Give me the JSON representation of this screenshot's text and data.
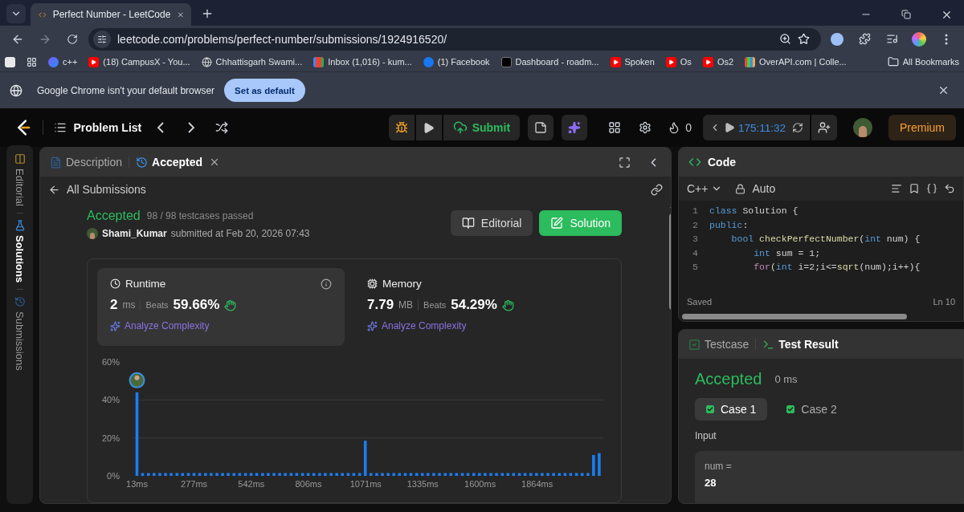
{
  "browser": {
    "tabs": [
      {
        "title": "Perfect Number - LeetCode",
        "selected": true
      }
    ],
    "url": "leetcode.com/problems/perfect-number/submissions/1924916520/",
    "bookmarks": [
      {
        "label": "c++",
        "kind": "site"
      },
      {
        "label": "(18) CampusX - You...",
        "kind": "youtube"
      },
      {
        "label": "Chhattisgarh Swami...",
        "kind": "globe"
      },
      {
        "label": "Inbox (1,016) - kum...",
        "kind": "mail"
      },
      {
        "label": "(1) Facebook",
        "kind": "facebook"
      },
      {
        "label": "Dashboard - roadm...",
        "kind": "dark"
      },
      {
        "label": "Spoken",
        "kind": "youtube"
      },
      {
        "label": "Os",
        "kind": "youtube"
      },
      {
        "label": "Os2",
        "kind": "youtube"
      },
      {
        "label": "OverAPI.com | Colle...",
        "kind": "stripes"
      }
    ],
    "all_bookmarks": "All Bookmarks",
    "infobar": {
      "message": "Google Chrome isn't your default browser",
      "button": "Set as default"
    }
  },
  "header": {
    "problem_list": "Problem List",
    "submit": "Submit",
    "streak": "0",
    "timer": "175:11:32",
    "premium": "Premium"
  },
  "side_tabs": [
    {
      "label": "Editorial",
      "selected": false
    },
    {
      "label": "Solutions",
      "selected": true
    },
    {
      "label": "Submissions",
      "selected": false
    }
  ],
  "left_panel": {
    "tabs": [
      {
        "label": "Description",
        "selected": false
      },
      {
        "label": "Accepted",
        "selected": true
      }
    ],
    "back_link": "All Submissions",
    "submission": {
      "status": "Accepted",
      "testcases": "98 / 98 testcases passed",
      "user": "Shami_Kumar",
      "submitted": "submitted at Feb 20, 2026 07:43",
      "buttons": [
        {
          "label": "Editorial",
          "kind": "secondary"
        },
        {
          "label": "Solution",
          "kind": "primary"
        }
      ]
    },
    "stats": [
      {
        "title": "Runtime",
        "value": "2",
        "unit": "ms",
        "beats_label": "Beats",
        "beats": "59.66%",
        "analyze": "Analyze Complexity",
        "selected": true
      },
      {
        "title": "Memory",
        "value": "7.79",
        "unit": "MB",
        "beats_label": "Beats",
        "beats": "54.29%",
        "analyze": "Analyze Complexity",
        "selected": false
      }
    ],
    "chart_data": {
      "type": "bar",
      "xlim": [
        0,
        2170
      ],
      "ylim": [
        0,
        60
      ],
      "yticks": [
        {
          "value": 0,
          "label": "0%"
        },
        {
          "value": 20,
          "label": "20%"
        },
        {
          "value": 40,
          "label": "40%"
        },
        {
          "value": 60,
          "label": "60%"
        }
      ],
      "xticks": [
        {
          "value": 13,
          "label": "13ms"
        },
        {
          "value": 277,
          "label": "277ms"
        },
        {
          "value": 542,
          "label": "542ms"
        },
        {
          "value": 806,
          "label": "806ms"
        },
        {
          "value": 1071,
          "label": "1071ms"
        },
        {
          "value": 1335,
          "label": "1335ms"
        },
        {
          "value": 1600,
          "label": "1600ms"
        },
        {
          "value": 1864,
          "label": "1864ms"
        }
      ],
      "x": [
        13,
        39,
        66,
        92,
        119,
        145,
        171,
        198,
        224,
        251,
        277,
        303,
        330,
        356,
        383,
        409,
        435,
        462,
        488,
        515,
        541,
        567,
        594,
        620,
        647,
        673,
        699,
        726,
        752,
        779,
        805,
        831,
        858,
        884,
        911,
        937,
        963,
        990,
        1016,
        1043,
        1069,
        1095,
        1122,
        1148,
        1175,
        1201,
        1227,
        1254,
        1280,
        1307,
        1333,
        1359,
        1386,
        1412,
        1439,
        1465,
        1491,
        1518,
        1544,
        1571,
        1597,
        1623,
        1650,
        1676,
        1703,
        1729,
        1755,
        1782,
        1808,
        1835,
        1861,
        1887,
        1914,
        1940,
        1967,
        1993,
        2019,
        2046,
        2072,
        2099,
        2125,
        2151
      ],
      "series": [
        {
          "color": "#1a7ef0",
          "values": [
            44,
            1.5,
            1.5,
            1.5,
            1.5,
            1.5,
            1.5,
            1.5,
            1.5,
            1.5,
            1.5,
            1.5,
            1.5,
            1.5,
            1.5,
            1.5,
            1.5,
            1.5,
            1.5,
            1.5,
            1.5,
            1.5,
            1.5,
            1.5,
            1.5,
            1.5,
            1.5,
            1.5,
            1.5,
            1.5,
            1.5,
            1.5,
            1.5,
            1.5,
            1.5,
            1.5,
            1.5,
            1.5,
            1.5,
            1.5,
            18.5,
            1.5,
            1.5,
            1.5,
            1.5,
            1.5,
            1.5,
            1.5,
            1.5,
            1.5,
            1.5,
            1.5,
            1.5,
            1.5,
            1.5,
            1.5,
            1.5,
            1.5,
            1.5,
            1.5,
            1.5,
            1.5,
            1.5,
            1.5,
            1.5,
            1.5,
            1.5,
            1.5,
            1.5,
            1.5,
            1.5,
            1.5,
            1.5,
            1.5,
            1.5,
            1.5,
            1.5,
            1.5,
            1.5,
            1.5,
            11,
            12
          ]
        }
      ]
    }
  },
  "code_panel": {
    "title": "Code",
    "language": "C++",
    "mode": "Auto",
    "lines": [
      {
        "number": "1",
        "tokens": [
          {
            "text": "class",
            "kind": "keyword"
          },
          {
            "text": " Solution {",
            "kind": "plain"
          }
        ]
      },
      {
        "number": "2",
        "tokens": [
          {
            "text": "public",
            "kind": "keyword"
          },
          {
            "text": ":",
            "kind": "plain"
          }
        ]
      },
      {
        "number": "3",
        "tokens": [
          {
            "text": "    bool",
            "kind": "keyword"
          },
          {
            "text": " checkPerfectNumber",
            "kind": "function"
          },
          {
            "text": "(",
            "kind": "plain"
          },
          {
            "text": "int",
            "kind": "keyword"
          },
          {
            "text": " num) {",
            "kind": "plain"
          }
        ]
      },
      {
        "number": "4",
        "tokens": [
          {
            "text": "        int",
            "kind": "keyword"
          },
          {
            "text": " sum = 1;",
            "kind": "plain"
          }
        ]
      },
      {
        "number": "5",
        "tokens": [
          {
            "text": "        for",
            "kind": "control"
          },
          {
            "text": "(",
            "kind": "plain"
          },
          {
            "text": "int",
            "kind": "keyword"
          },
          {
            "text": " i=2;i<=",
            "kind": "plain"
          },
          {
            "text": "sqrt",
            "kind": "function"
          },
          {
            "text": "(num);i++){",
            "kind": "plain"
          }
        ]
      }
    ],
    "status": "Saved",
    "position": "Ln 10"
  },
  "result_panel": {
    "tabs": [
      {
        "label": "Testcase",
        "selected": false
      },
      {
        "label": "Test Result",
        "selected": true
      }
    ],
    "status": "Accepted",
    "time": "0 ms",
    "cases": [
      {
        "label": "Case 1",
        "selected": true,
        "passed": true
      },
      {
        "label": "Case 2",
        "selected": false,
        "passed": true
      }
    ],
    "input_label": "Input",
    "variable": "num =",
    "value": "28"
  }
}
